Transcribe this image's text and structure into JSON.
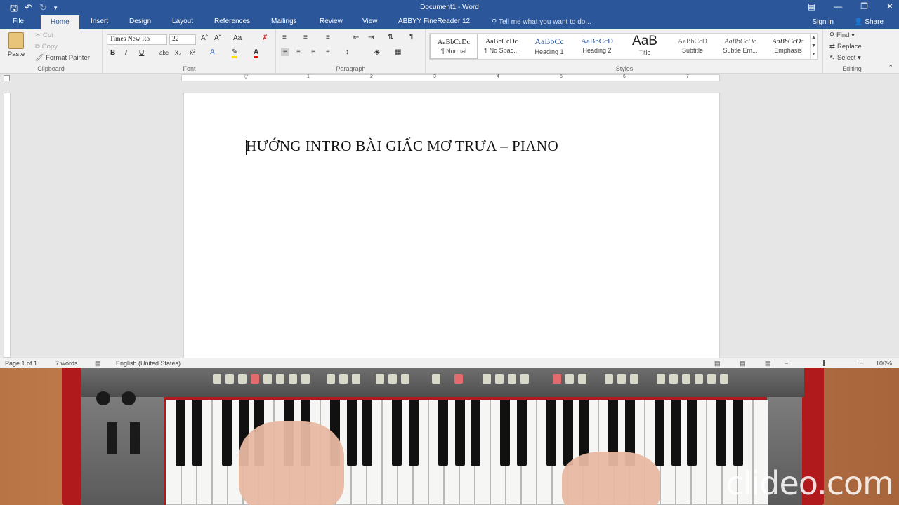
{
  "titlebar": {
    "title": "Document1 - Word",
    "qat": {
      "save_icon": "save-icon",
      "undo_icon": "undo-icon",
      "redo_icon": "redo-icon",
      "customize_icon": "customize-qat-icon"
    }
  },
  "tabs": {
    "file": "File",
    "home": "Home",
    "insert": "Insert",
    "design": "Design",
    "layout": "Layout",
    "references": "References",
    "mailings": "Mailings",
    "review": "Review",
    "view": "View",
    "abbyy": "ABBYY FineReader 12"
  },
  "tell_me": "Tell me what you want to do...",
  "sign_in": "Sign in",
  "share": "Share",
  "clipboard": {
    "paste": "Paste",
    "cut": "Cut",
    "copy": "Copy",
    "format_painter": "Format Painter",
    "label": "Clipboard"
  },
  "font": {
    "name": "Times New Ro",
    "size": "22",
    "label": "Font"
  },
  "paragraph": {
    "label": "Paragraph"
  },
  "styles": {
    "label": "Styles",
    "items": [
      {
        "sample": "AaBbCcDc",
        "name": "¶ Normal"
      },
      {
        "sample": "AaBbCcDc",
        "name": "¶ No Spac..."
      },
      {
        "sample": "AaBbCc",
        "name": "Heading 1"
      },
      {
        "sample": "AaBbCcD",
        "name": "Heading 2"
      },
      {
        "sample": "AaB",
        "name": "Title"
      },
      {
        "sample": "AaBbCcD",
        "name": "Subtitle"
      },
      {
        "sample": "AaBbCcDc",
        "name": "Subtle Em..."
      },
      {
        "sample": "AaBbCcDc",
        "name": "Emphasis"
      }
    ]
  },
  "editing": {
    "find": "Find",
    "replace": "Replace",
    "select": "Select",
    "label": "Editing"
  },
  "ruler": {
    "h_numbers": [
      "1",
      "1",
      "2",
      "3",
      "4",
      "5",
      "6",
      "7"
    ]
  },
  "document": {
    "text": "HƯỚNG INTRO BÀI GIẤC MƠ TRƯA – PIANO"
  },
  "status": {
    "page": "Page 1 of 1",
    "words": "7 words",
    "language": "English (United States)",
    "zoom": "100%"
  },
  "watermark": "clideo.com",
  "colors": {
    "title_bar": "#2b579a",
    "ribbon": "#f1f1f1",
    "keyboard_red": "#b01a1c"
  }
}
